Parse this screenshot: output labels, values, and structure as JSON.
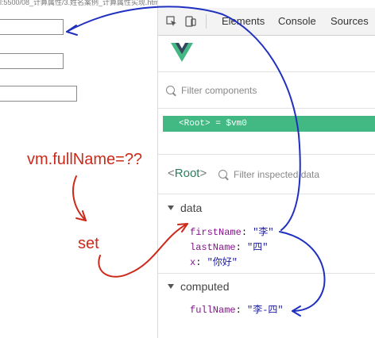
{
  "url": "l:5500/08_计算属性/3.姓名案例_计算属性实现.html",
  "devtools": {
    "tabs": [
      "Elements",
      "Console",
      "Sources"
    ],
    "filter_components_placeholder": "Filter components",
    "root_row": "<Root> = $vm0",
    "root_title_open": "<",
    "root_title_name": "Root",
    "root_title_close": ">",
    "filter_inspected_placeholder": "Filter inspected data",
    "sections": {
      "data_label": "data",
      "computed_label": "computed"
    },
    "data": [
      {
        "key": "firstName",
        "value": "\"李\""
      },
      {
        "key": "lastName",
        "value": "\"四\""
      },
      {
        "key": "x",
        "value": "\"你好\""
      }
    ],
    "computed": [
      {
        "key": "fullName",
        "value": "\"李-四\""
      }
    ]
  },
  "annotations": {
    "question": "vm.fullName=??",
    "set": "set",
    "red": "#cc2a1b",
    "blue": "#1f2fbf"
  },
  "colors": {
    "vue_green": "#42b883"
  }
}
